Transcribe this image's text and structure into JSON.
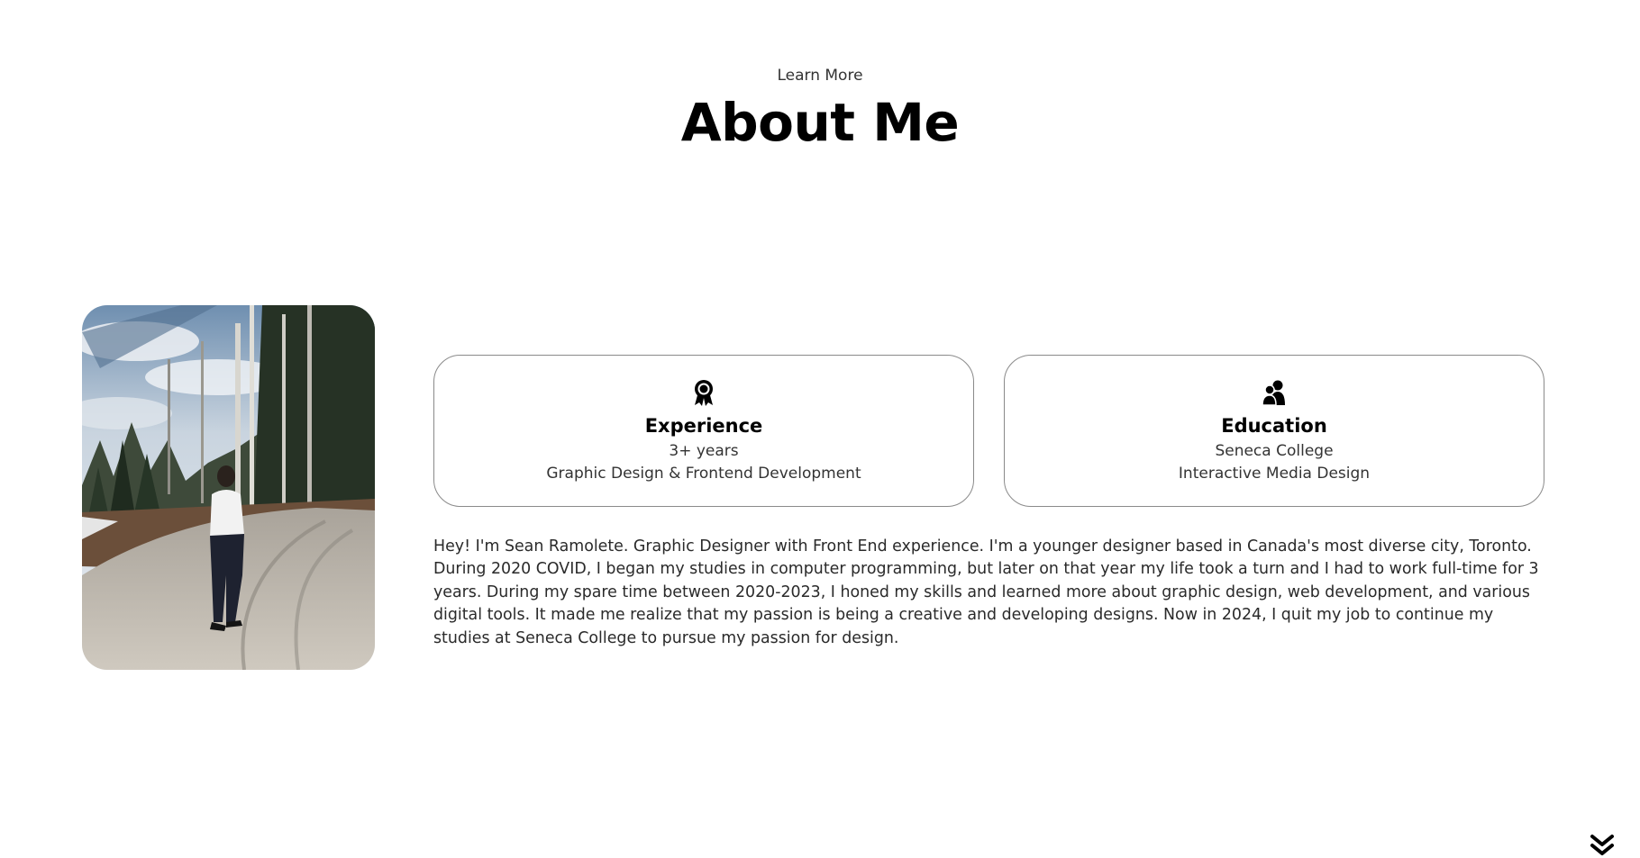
{
  "header": {
    "subtitle": "Learn More",
    "title": "About Me"
  },
  "profile": {
    "photo_icon": "profile-photo"
  },
  "cards": {
    "experience": {
      "icon": "award-icon",
      "title": "Experience",
      "line1": "3+ years",
      "line2": "Graphic Design & Frontend Development"
    },
    "education": {
      "icon": "users-icon",
      "title": "Education",
      "line1": "Seneca College",
      "line2": "Interactive Media Design"
    }
  },
  "bio": {
    "text": "Hey! I'm Sean Ramolete. Graphic Designer with Front End experience. I'm a younger designer based in Canada's most diverse city, Toronto. During 2020 COVID, I began my studies in computer programming, but later on that year my life took a turn and I had to work full-time for 3 years. During my spare time between 2020-2023, I honed my skills and learned more about graphic design, web development, and various digital tools. It made me realize that my passion is being a creative and developing designs. Now in 2024, I quit my job to continue my studies at Seneca College to pursue my passion for design."
  },
  "navigation": {
    "scroll_icon": "double-chevron-down-icon"
  },
  "colors": {
    "text": "#222222",
    "heading": "#000000",
    "card_border": "#8a8a8a",
    "background": "#ffffff"
  }
}
